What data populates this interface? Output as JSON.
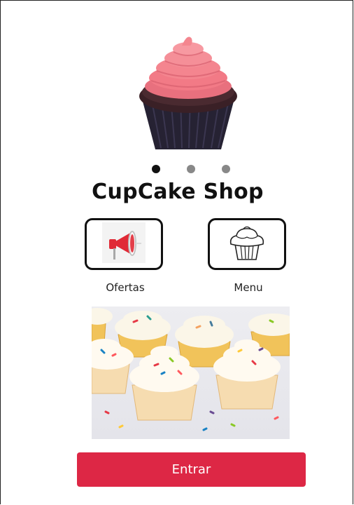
{
  "app": {
    "title": "CupCake Shop"
  },
  "carousel": {
    "slide_count": 3,
    "active_index": 0
  },
  "tiles": [
    {
      "label": "Ofertas",
      "icon": "megaphone-icon"
    },
    {
      "label": "Menu",
      "icon": "cupcake-icon"
    }
  ],
  "enter_button": {
    "label": "Entrar"
  },
  "colors": {
    "primary": "#dd2745",
    "frosting": "#f27a86",
    "cake": "#3a2026",
    "text": "#111111"
  }
}
